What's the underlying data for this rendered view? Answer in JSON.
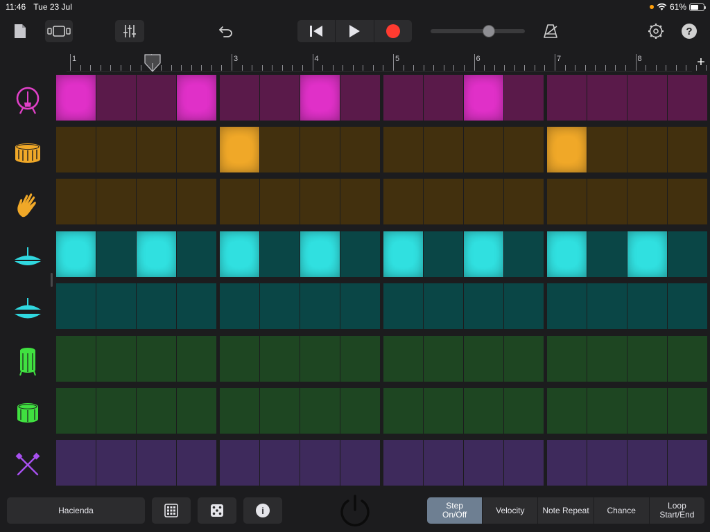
{
  "status": {
    "time": "11:46",
    "date": "Tue 23 Jul",
    "battery": "61%",
    "battery_level": 0.61
  },
  "toolbar": {
    "buttons": [
      "document-icon",
      "browser-view-icon",
      "mixer-icon",
      "undo-icon"
    ],
    "transport": [
      "go-to-beginning-icon",
      "play-icon",
      "record-icon"
    ],
    "volume_level": 0.62,
    "right": [
      "metronome-icon",
      "settings-icon",
      "help-icon"
    ],
    "help_glyph": "?"
  },
  "ruler": {
    "bars": [
      "1",
      "2",
      "3",
      "4",
      "5",
      "6",
      "7",
      "8"
    ],
    "add_label": "+"
  },
  "colors": {
    "kick_on": "#e030c8",
    "kick_off": "#5a1a4a",
    "snare_on": "#f0a828",
    "snare_off": "#42300e",
    "clap_off": "#42300e",
    "hat_on": "#30e0e0",
    "hat_off": "#0a4646",
    "tom_off": "#1e4622",
    "perc_off": "#3e2a5c"
  },
  "tracks": [
    {
      "name": "kick-drum",
      "icon": "kick-drum-icon",
      "color_on": "#e030c8",
      "color_off": "#5a1a4a",
      "icon_color": "#e040c8",
      "steps": [
        1,
        0,
        0,
        1,
        0,
        0,
        1,
        0,
        0,
        0,
        1,
        0,
        0,
        0,
        0,
        0
      ]
    },
    {
      "name": "snare-drum",
      "icon": "snare-drum-icon",
      "color_on": "#f0a828",
      "color_off": "#42300e",
      "icon_color": "#f0a828",
      "steps": [
        0,
        0,
        0,
        0,
        1,
        0,
        0,
        0,
        0,
        0,
        0,
        0,
        1,
        0,
        0,
        0
      ]
    },
    {
      "name": "hand-clap",
      "icon": "hand-clap-icon",
      "color_on": "#f0a828",
      "color_off": "#42300e",
      "icon_color": "#f0a828",
      "steps": [
        0,
        0,
        0,
        0,
        0,
        0,
        0,
        0,
        0,
        0,
        0,
        0,
        0,
        0,
        0,
        0
      ]
    },
    {
      "name": "closed-hi-hat",
      "icon": "closed-hi-hat-icon",
      "color_on": "#30e0e0",
      "color_off": "#0a4646",
      "icon_color": "#30d8e0",
      "steps": [
        1,
        0,
        1,
        0,
        1,
        0,
        1,
        0,
        1,
        0,
        1,
        0,
        1,
        0,
        1,
        0
      ]
    },
    {
      "name": "open-hi-hat",
      "icon": "open-hi-hat-icon",
      "color_on": "#30e0e0",
      "color_off": "#0a4646",
      "icon_color": "#30d8e0",
      "steps": [
        0,
        0,
        0,
        0,
        0,
        0,
        0,
        0,
        0,
        0,
        0,
        0,
        0,
        0,
        0,
        0
      ]
    },
    {
      "name": "floor-tom",
      "icon": "floor-tom-icon",
      "color_on": "#40e040",
      "color_off": "#1e4622",
      "icon_color": "#40e040",
      "steps": [
        0,
        0,
        0,
        0,
        0,
        0,
        0,
        0,
        0,
        0,
        0,
        0,
        0,
        0,
        0,
        0
      ]
    },
    {
      "name": "rack-tom",
      "icon": "rack-tom-icon",
      "color_on": "#40e040",
      "color_off": "#1e4622",
      "icon_color": "#40e040",
      "steps": [
        0,
        0,
        0,
        0,
        0,
        0,
        0,
        0,
        0,
        0,
        0,
        0,
        0,
        0,
        0,
        0
      ]
    },
    {
      "name": "sticks",
      "icon": "drum-sticks-icon",
      "color_on": "#b060f0",
      "color_off": "#3e2a5c",
      "icon_color": "#a850f0",
      "steps": [
        0,
        0,
        0,
        0,
        0,
        0,
        0,
        0,
        0,
        0,
        0,
        0,
        0,
        0,
        0,
        0
      ]
    }
  ],
  "bottom": {
    "kit_name": "Hacienda",
    "buttons": [
      "pattern-grid-icon",
      "randomize-dice-icon",
      "info-icon"
    ],
    "info_glyph": "i",
    "power": "power-icon",
    "modes": [
      {
        "label": "Step\nOn/Off",
        "active": true
      },
      {
        "label": "Velocity",
        "active": false
      },
      {
        "label": "Note Repeat",
        "active": false
      },
      {
        "label": "Chance",
        "active": false
      },
      {
        "label": "Loop\nStart/End",
        "active": false
      }
    ]
  }
}
